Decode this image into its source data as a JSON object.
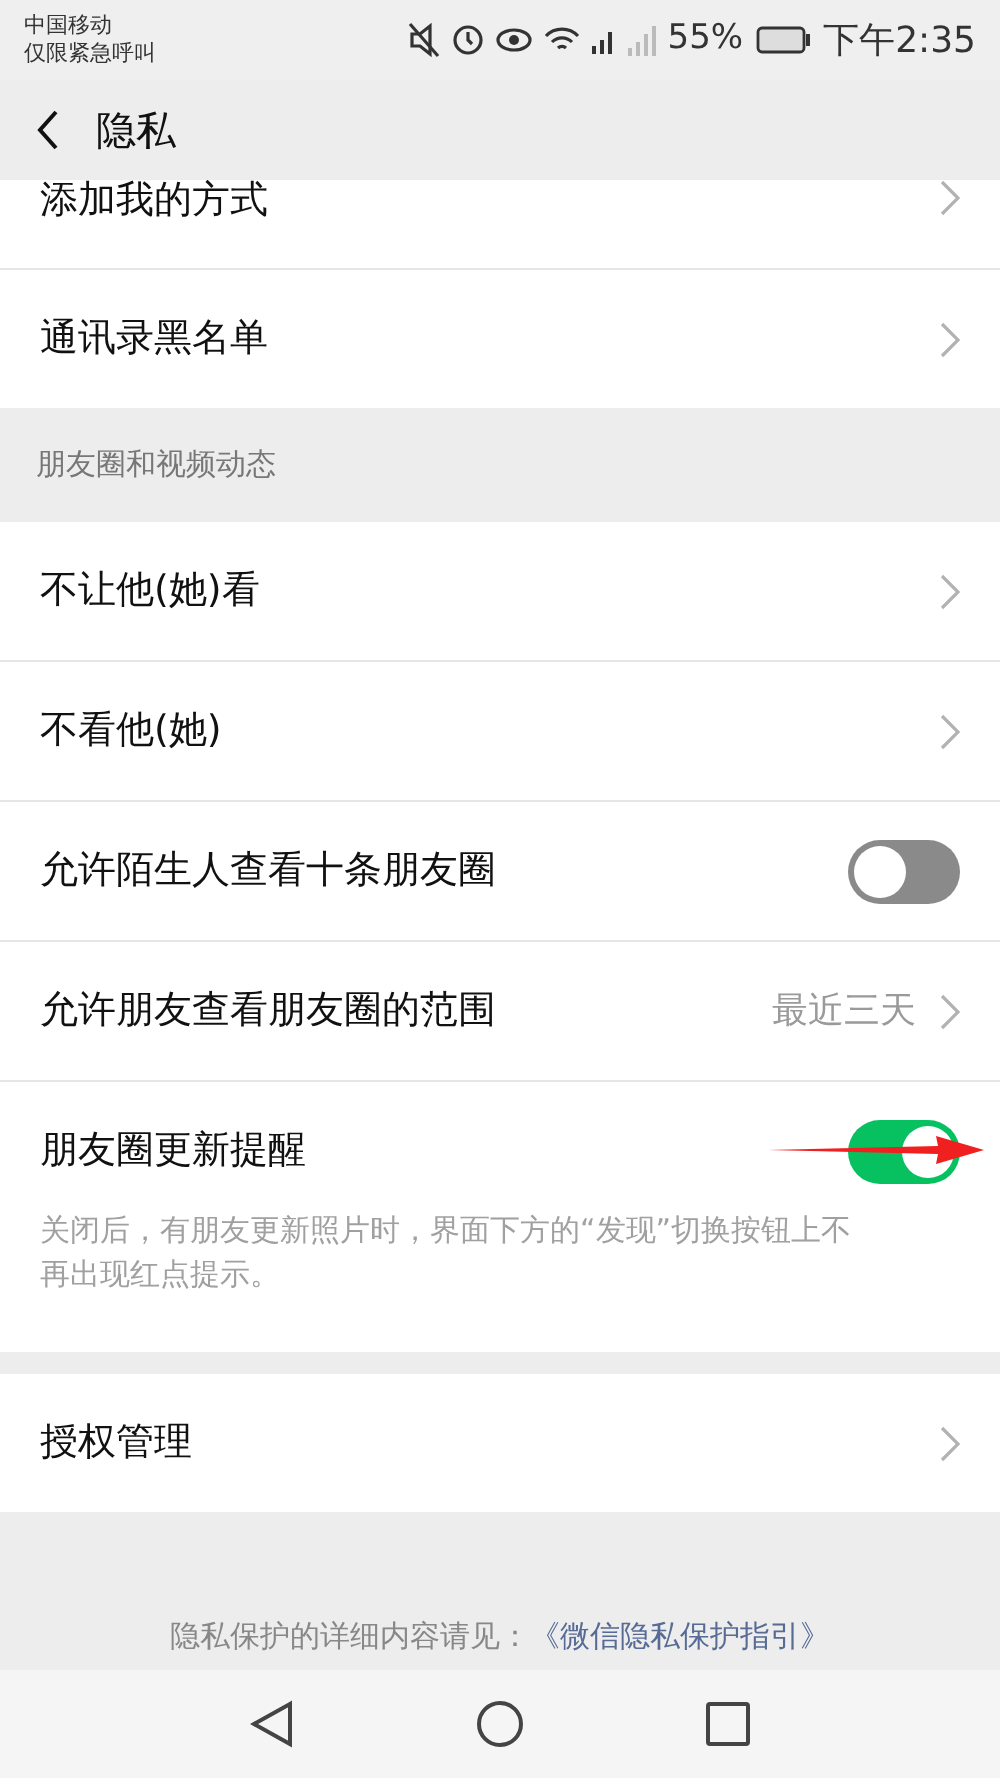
{
  "status_bar": {
    "carrier": "中国移动",
    "carrier_note": "仅限紧急呼叫",
    "battery": "55%",
    "time": "下午2:35"
  },
  "header": {
    "title": "隐私"
  },
  "sections": [
    {
      "rows": [
        {
          "kind": "nav",
          "label": "添加我的方式",
          "partial": true
        },
        {
          "kind": "nav",
          "label": "通讯录黑名单"
        }
      ]
    },
    {
      "title": "朋友圈和视频动态",
      "rows": [
        {
          "kind": "nav",
          "label": "不让他(她)看"
        },
        {
          "kind": "nav",
          "label": "不看他(她)"
        },
        {
          "kind": "toggle",
          "label": "允许陌生人查看十条朋友圈",
          "on": false
        },
        {
          "kind": "value",
          "label": "允许朋友查看朋友圈的范围",
          "value": "最近三天"
        },
        {
          "kind": "toggle",
          "label": "朋友圈更新提醒",
          "on": true,
          "note": "关闭后，有朋友更新照片时，界面下方的“发现”切换按钮上不再出现红点提示。",
          "annotated": true
        }
      ]
    },
    {
      "rows": [
        {
          "kind": "nav",
          "label": "授权管理"
        }
      ]
    }
  ],
  "footer": {
    "text": "隐私保护的详细内容请见：",
    "link": "《微信隐私保护指引》"
  }
}
